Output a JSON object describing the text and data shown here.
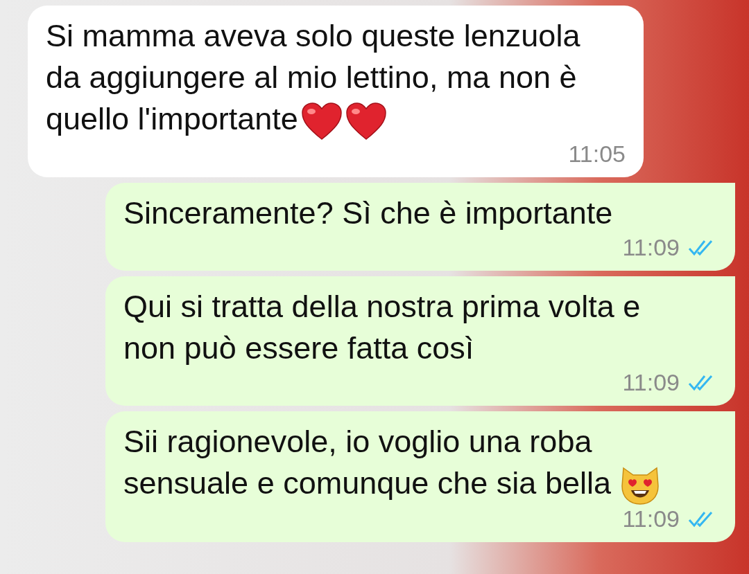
{
  "messages": [
    {
      "kind": "received",
      "text": "Si mamma aveva solo queste lenzuola da aggiungere al mio lettino, ma non è quello l'importante",
      "trailing_icons": [
        {
          "kind": "heart"
        },
        {
          "kind": "heart"
        }
      ],
      "time": "11:05"
    },
    {
      "kind": "sent",
      "text": "Sinceramente? Sì che è importante",
      "time": "11:09",
      "read": true
    },
    {
      "kind": "sent",
      "text": "Qui si tratta della nostra prima volta e non può essere fatta così",
      "time": "11:09",
      "read": true
    },
    {
      "kind": "sent",
      "text": "Sii ragionevole, io voglio una roba sensuale e comunque che sia bella",
      "trailing_icons": [
        {
          "kind": "heart-eyes-cat"
        }
      ],
      "time": "11:09",
      "read": true
    }
  ]
}
